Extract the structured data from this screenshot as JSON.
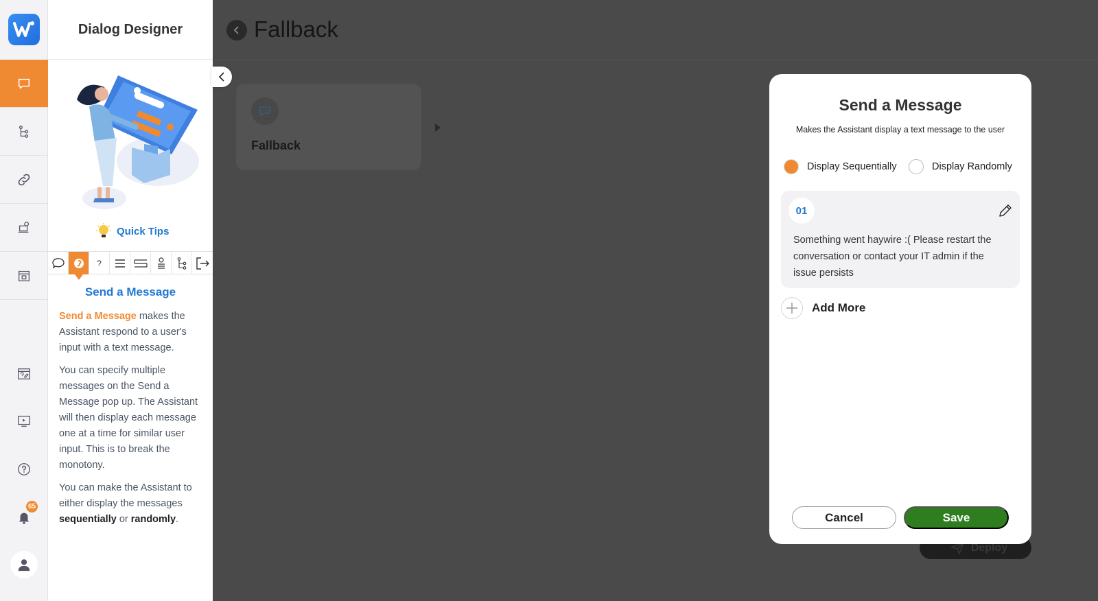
{
  "app": {
    "section_title": "Dialog Designer",
    "logo_icon": "w-logo-icon",
    "accent_color": "#f08a32",
    "link_color": "#1f78d1",
    "save_color": "#2e7d1f"
  },
  "rail": {
    "items": [
      {
        "name": "dialog",
        "icon": "speech-bubble-icon",
        "active": true
      },
      {
        "name": "flow",
        "icon": "tree-branch-icon",
        "active": false
      },
      {
        "name": "integrations",
        "icon": "link-icon",
        "active": false
      },
      {
        "name": "agent",
        "icon": "agent-desk-icon",
        "active": false
      },
      {
        "name": "marketplace",
        "icon": "store-icon",
        "active": false
      }
    ],
    "bottom": [
      {
        "name": "faq",
        "icon": "faq-board-icon"
      },
      {
        "name": "preview",
        "icon": "play-screen-icon"
      },
      {
        "name": "help",
        "icon": "help-icon"
      },
      {
        "name": "notifications",
        "icon": "bell-icon",
        "badge": "65"
      },
      {
        "name": "profile",
        "icon": "user-icon"
      }
    ]
  },
  "tips": {
    "quick_tips_label": "Quick Tips",
    "tabs": [
      "speech-bubble-icon",
      "send-message-icon",
      "question-icon",
      "list-icon",
      "options-icon",
      "variable-icon",
      "flow-icon",
      "exit-icon"
    ],
    "tab_question_glyph": "?",
    "heading": "Send a Message",
    "para1_highlight": "Send a Message",
    "para1_rest": " makes the Assistant respond to a user's input with a text message.",
    "para2": "You can specify multiple messages on the Send a Message pop up. The Assistant will then display each message one at a time for similar user input. This is to break the monotony.",
    "para3_a": "You can make the Assistant to either display the messages ",
    "para3_b": "sequentially",
    "para3_c": " or ",
    "para3_d": "randomly",
    "para3_e": "."
  },
  "canvas": {
    "page_title": "Fallback",
    "node_label": "Fallback",
    "deploy_label": "Deploy"
  },
  "modal": {
    "title": "Send a Message",
    "subtitle": "Makes the Assistant display a text message to the user",
    "radio_sequential": "Display Sequentially",
    "radio_random": "Display Randomly",
    "selected": "sequential",
    "messages": [
      {
        "number": "01",
        "text": "Something went haywire :( Please restart the conversation or contact your IT admin if the issue persists"
      }
    ],
    "add_more_label": "Add More",
    "cancel_label": "Cancel",
    "save_label": "Save"
  }
}
